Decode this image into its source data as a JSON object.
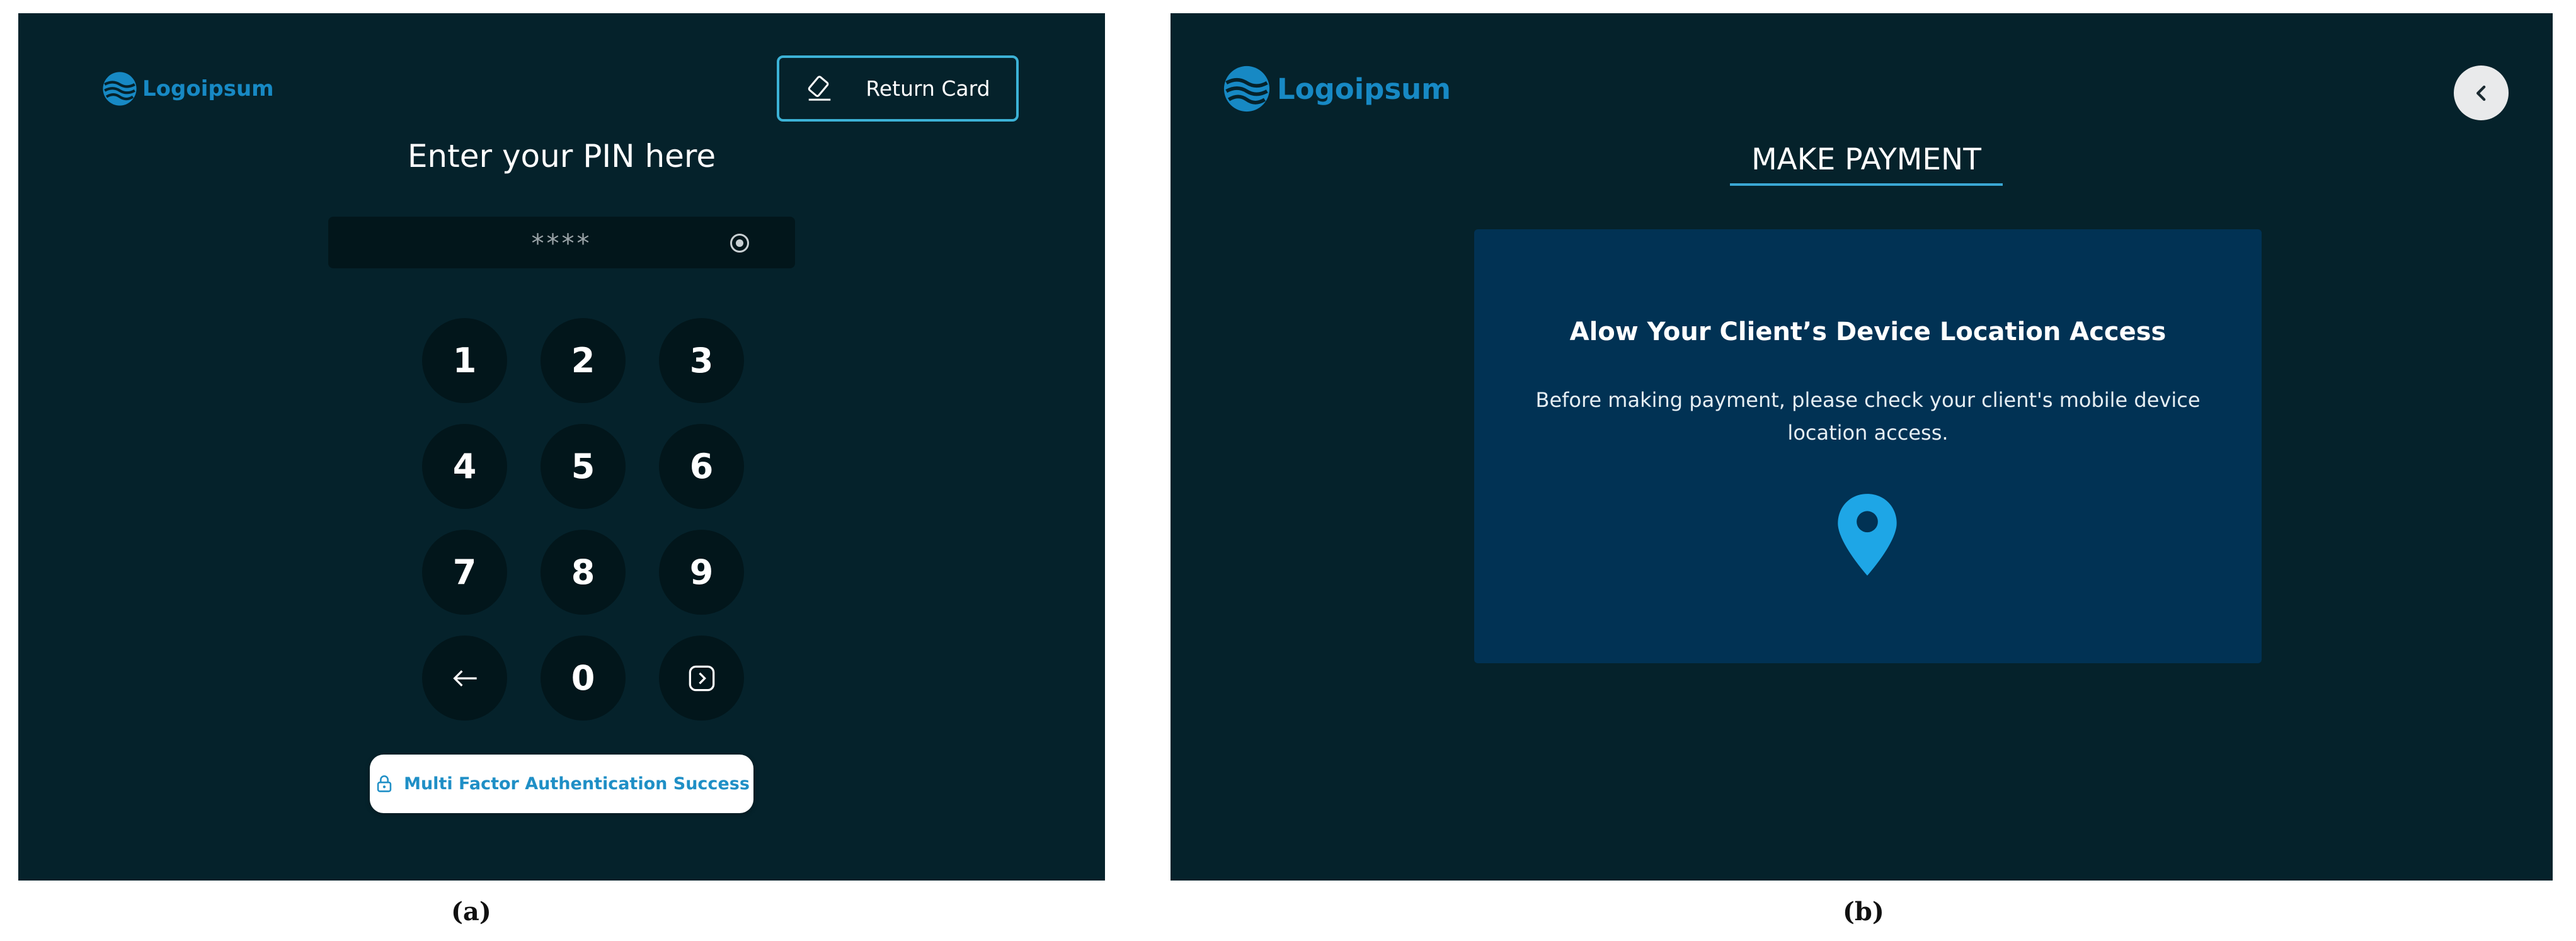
{
  "screen_a": {
    "logo_text": "Logoipsum",
    "return_card_label": "Return Card",
    "pin_title": "Enter your PIN here",
    "pin_mask": "****",
    "keypad": [
      "1",
      "2",
      "3",
      "4",
      "5",
      "6",
      "7",
      "8",
      "9",
      "0"
    ],
    "mfa_text": "Multi Factor Authentication Success",
    "caption": "(a)"
  },
  "screen_b": {
    "logo_text": "Logoipsum",
    "title": "MAKE PAYMENT",
    "card_title": "Alow Your Client’s Device Location Access",
    "card_body": "Before making payment, please check your client's mobile device location access.",
    "caption": "(b)"
  },
  "icons": {
    "logo": "logo-wave-icon",
    "return_card": "card-eject-icon",
    "pin_clear": "clear-circle-icon",
    "backspace": "arrow-left-icon",
    "submit": "chevron-right-square-icon",
    "mfa": "lock-icon",
    "back": "chevron-left-icon",
    "location": "location-pin-icon"
  },
  "colors": {
    "background": "#05222b",
    "key_background": "#02161b",
    "accent": "#1f8fc6",
    "card_background": "#013254",
    "location_pin": "#1ea6e6"
  }
}
